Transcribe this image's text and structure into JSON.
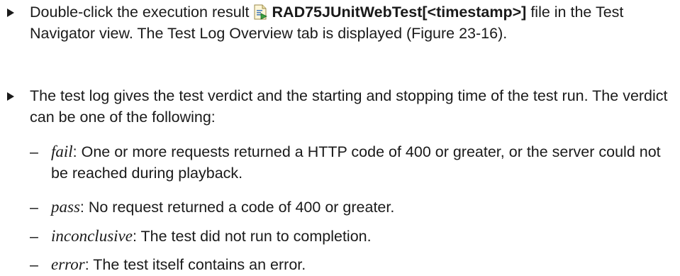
{
  "bullets": [
    {
      "pre": "Double-click the execution result",
      "icon": "test-log-file-icon",
      "bold": "RAD75JUnitWebTest[<timestamp>]",
      "post": "file in the Test Navigator view. The Test Log Overview tab is displayed (Figure 23-16)."
    },
    {
      "text": "The test log gives the test verdict and the starting and stopping time of the test run. The verdict can be one of the following:"
    }
  ],
  "dash": "–",
  "verdicts": [
    {
      "term": "fail",
      "desc": ": One or more requests returned a HTTP code of 400 or greater, or the server could not be reached during playback."
    },
    {
      "term": "pass",
      "desc": ": No request returned a code of 400 or greater."
    },
    {
      "term": "inconclusive",
      "desc": ": The test did not run to completion."
    },
    {
      "term": "error",
      "desc": ": The test itself contains an error."
    }
  ]
}
